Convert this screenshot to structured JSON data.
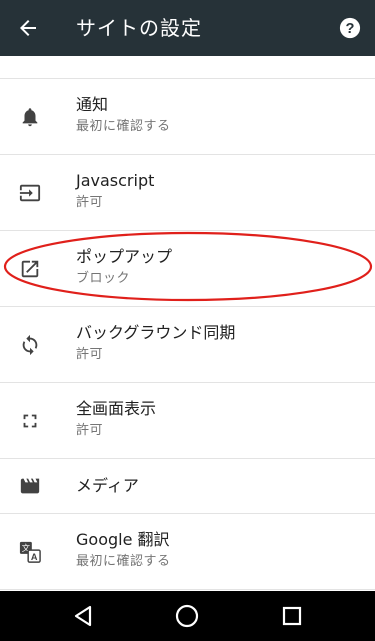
{
  "app_bar": {
    "title": "サイトの設定",
    "background": "#263238",
    "back_icon": "arrow-back-icon",
    "help_icon": "help-icon"
  },
  "settings": [
    {
      "icon": "bell-icon",
      "title": "通知",
      "subtitle": "最初に確認する"
    },
    {
      "icon": "javascript-icon",
      "title": "Javascript",
      "subtitle": "許可"
    },
    {
      "icon": "popup-icon",
      "title": "ポップアップ",
      "subtitle": "ブロック"
    },
    {
      "icon": "sync-icon",
      "title": "バックグラウンド同期",
      "subtitle": "許可"
    },
    {
      "icon": "fullscreen-icon",
      "title": "全画面表示",
      "subtitle": "許可"
    },
    {
      "icon": "media-icon",
      "title": "メディア"
    },
    {
      "icon": "translate-icon",
      "title": "Google 翻訳",
      "subtitle": "最初に確認する"
    }
  ],
  "annotation": {
    "target": "ポップアップ",
    "color": "#e0201b"
  },
  "nav_bar": {
    "back_icon": "nav-back-icon",
    "home_icon": "nav-home-icon",
    "recents_icon": "nav-recents-icon"
  }
}
